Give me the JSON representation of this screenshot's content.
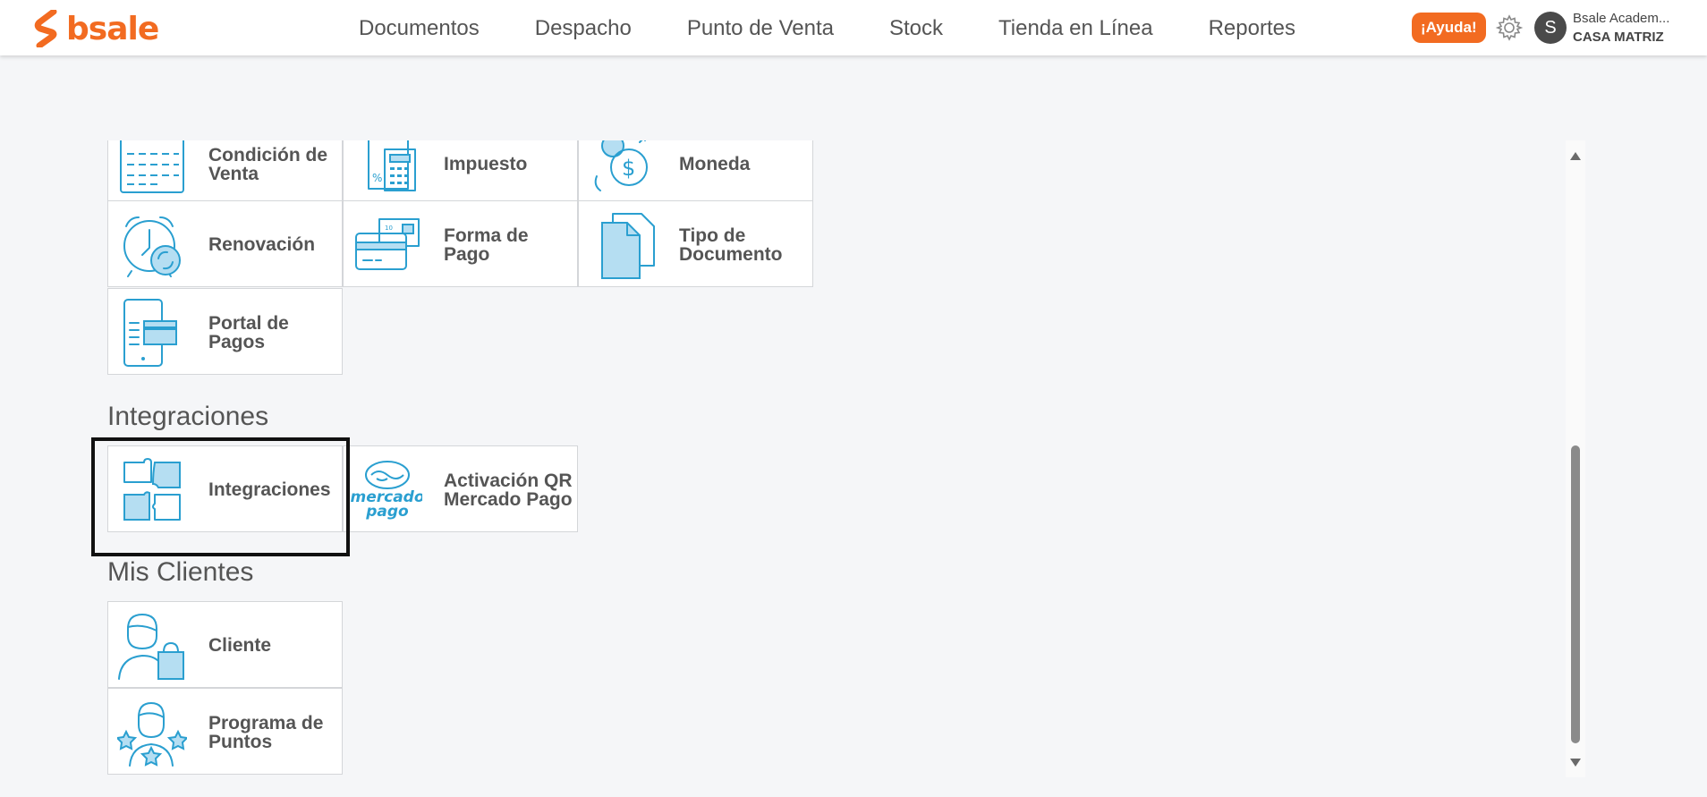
{
  "app": {
    "brand": "bsale",
    "brand_color": "#f26b21",
    "accent_color": "#2a9fd0"
  },
  "nav": {
    "items": [
      {
        "label": "Documentos"
      },
      {
        "label": "Despacho"
      },
      {
        "label": "Punto de Venta"
      },
      {
        "label": "Stock"
      },
      {
        "label": "Tienda en Línea"
      },
      {
        "label": "Reportes"
      }
    ]
  },
  "header": {
    "help_label": "¡Ayuda!",
    "settings_icon": "gear-icon",
    "avatar_initial": "S",
    "user_name": "Bsale Academ...",
    "user_branch": "CASA MATRIZ"
  },
  "tiles": {
    "condicion_venta": {
      "line1": "Condición de",
      "line2": "Venta",
      "icon": "calendar-icon"
    },
    "impuesto": {
      "label": "Impuesto",
      "icon": "calculator-icon"
    },
    "moneda": {
      "label": "Moneda",
      "icon": "currency-exchange-icon"
    },
    "renovacion": {
      "label": "Renovación",
      "icon": "alarm-clock-icon"
    },
    "forma_pago": {
      "label": "Forma de Pago",
      "icon": "payment-cards-icon"
    },
    "tipo_documento": {
      "line1": "Tipo de",
      "line2": "Documento",
      "icon": "document-icon"
    },
    "portal_pagos": {
      "line1": "Portal de",
      "line2": "Pagos",
      "icon": "mobile-payment-icon"
    },
    "integraciones": {
      "label": "Integraciones",
      "icon": "puzzle-icon"
    },
    "qr_mercado_pago": {
      "line1": "Activación QR",
      "line2": "Mercado Pago",
      "icon": "mercado-pago-logo",
      "logo_line1": "mercado",
      "logo_line2": "pago"
    },
    "cliente": {
      "label": "Cliente",
      "icon": "customer-icon"
    },
    "programa_puntos": {
      "line1": "Programa de",
      "line2": "Puntos",
      "icon": "loyalty-stars-icon"
    }
  },
  "sections": {
    "integraciones": "Integraciones",
    "mis_clientes": "Mis Clientes"
  }
}
